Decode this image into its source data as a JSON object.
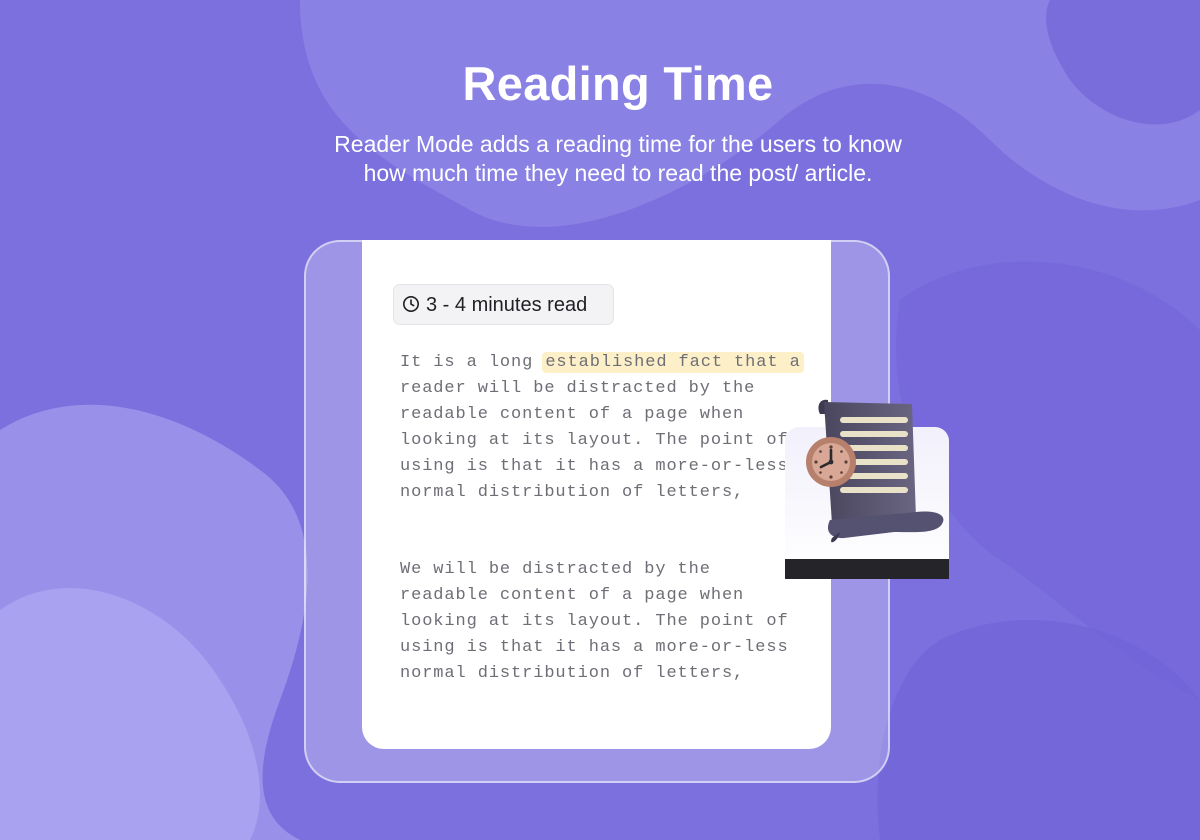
{
  "hero": {
    "title": "Reading Time",
    "subtitle": "Reader Mode adds a reading time for the users to know how much time they need to read the post/ article."
  },
  "badge": {
    "icon": "clock-icon",
    "text": "3 - 4 minutes read"
  },
  "article": {
    "paragraph1": {
      "before_highlight": "It is a long ",
      "highlight": "established fact that a",
      "lines": [
        "reader will be distracted by the",
        "readable content of a page when",
        "looking at its layout. The point of",
        "using is that it has a more-or-less",
        "normal distribution of letters,"
      ]
    },
    "paragraph2": {
      "lines": [
        "We will be distracted by the",
        "readable content of a page when",
        "looking at its layout. The point of",
        "using is that it has a more-or-less",
        "normal distribution of letters,"
      ]
    }
  },
  "illustration": {
    "icon": "scroll-with-clock-icon"
  },
  "colors": {
    "background": "#7c70de",
    "highlight": "#fdf0c8",
    "card": "#ffffff",
    "scroll": "#5a5670",
    "clock": "#c9927e"
  }
}
